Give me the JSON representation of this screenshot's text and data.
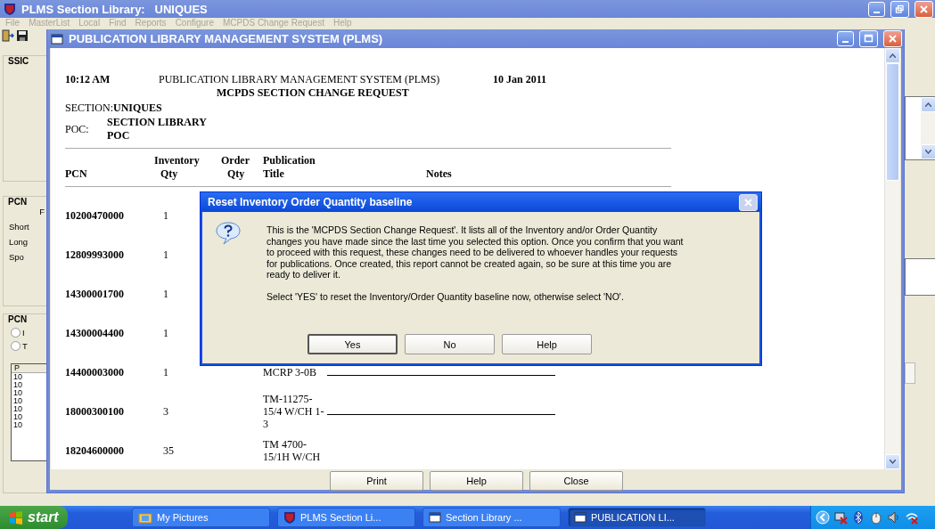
{
  "main_window": {
    "title": "PLMS Section Library:   UNIQUES",
    "menu": [
      {
        "label": "File",
        "disabled": true
      },
      {
        "label": "MasterList",
        "disabled": true
      },
      {
        "label": "Local",
        "disabled": true
      },
      {
        "label": "Find",
        "disabled": true
      },
      {
        "label": "Reports",
        "disabled": true
      },
      {
        "label": "Configure",
        "disabled": true
      },
      {
        "label": "MCPDS Change Request",
        "disabled": true
      },
      {
        "label": "Help",
        "disabled": true
      }
    ],
    "left_panel": {
      "ssic_label": "SSIC",
      "pcn_label": "PCN",
      "pcn_caption": "F",
      "field_labels": [
        "Short",
        "Long",
        "Spo"
      ],
      "second_pcn_label": "PCN",
      "radios": [
        {
          "label": "I",
          "selected": false
        },
        {
          "label": "T",
          "selected": false
        }
      ],
      "list": {
        "header": "P",
        "rows": [
          "10",
          "10",
          "10",
          "10",
          "10",
          "10",
          "10"
        ]
      }
    }
  },
  "report_window": {
    "title": "PUBLICATION LIBRARY MANAGEMENT SYSTEM (PLMS)",
    "report": {
      "time": "10:12 AM",
      "system_title": "PUBLICATION LIBRARY MANAGEMENT SYSTEM (PLMS)",
      "date": "10 Jan 2011",
      "report_title": "MCPDS SECTION CHANGE REQUEST",
      "section_label": "SECTION:",
      "section_value": "UNIQUES",
      "poc_label": "POC:",
      "poc_value": "SECTION LIBRARY POC",
      "columns": [
        {
          "bottom": "PCN"
        },
        {
          "top": "Inventory",
          "bottom": "Qty"
        },
        {
          "top": "Order",
          "bottom": "Qty"
        },
        {
          "top": "Publication",
          "bottom": "Title"
        },
        {
          "bottom": "Notes"
        }
      ],
      "rows": [
        {
          "pcn": "10200470000",
          "inventory_qty": "1",
          "notes_line": false
        },
        {
          "pcn": "12809993000",
          "inventory_qty": "1",
          "notes_line": false
        },
        {
          "pcn": "14300001700",
          "inventory_qty": "1",
          "notes_line": false
        },
        {
          "pcn": "14300004400",
          "inventory_qty": "1",
          "notes_line": false
        },
        {
          "pcn": "14400003000",
          "inventory_qty": "1",
          "title": "MCRP 3-0B",
          "notes_line": true
        },
        {
          "pcn": "18000300100",
          "inventory_qty": "3",
          "title": "TM-11275-15/4 W/CH 1-3",
          "notes_line": true
        },
        {
          "pcn": "18204600000",
          "inventory_qty": "35",
          "title": "TM 4700-15/1H W/CH",
          "notes_line": false
        }
      ]
    },
    "buttons": [
      "Print",
      "Help",
      "Close"
    ]
  },
  "dialog": {
    "title": "Reset Inventory Order Quantity baseline",
    "close_disabled": true,
    "message": "This is the 'MCPDS Section Change Request'.  It lists all of the Inventory and/or Order Quantity changes you have made since the last time you selected this option.  Once you confirm that you want to proceed with this request, these changes need to be delivered to whoever handles your requests for publications.  Once created, this report cannot be created again, so be sure at this time you are ready to deliver it.",
    "prompt": "Select 'YES' to reset the Inventory/Order Quantity baseline now, otherwise select 'NO'.",
    "buttons": [
      {
        "label": "Yes",
        "default": true
      },
      {
        "label": "No",
        "default": false
      },
      {
        "label": "Help",
        "default": false
      }
    ]
  },
  "taskbar": {
    "start": "start",
    "items": [
      {
        "label": "My Pictures",
        "kind": "folder",
        "selected": false
      },
      {
        "label": "PLMS Section Li...",
        "kind": "shield",
        "selected": false
      },
      {
        "label": "Section Library ...",
        "kind": "window",
        "selected": false
      },
      {
        "label": "PUBLICATION LI...",
        "kind": "window",
        "selected": true
      }
    ]
  }
}
